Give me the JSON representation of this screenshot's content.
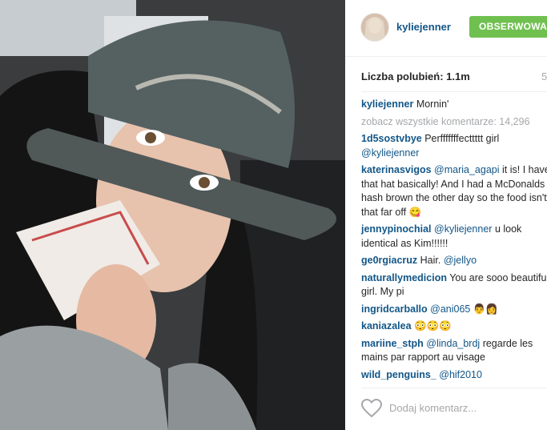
{
  "post": {
    "username": "kyliejenner",
    "follow_label": "OBSERWOWANE",
    "likes_label": "Liczba polubień: 1.1m",
    "time": "5",
    "caption": {
      "user": "kyliejenner",
      "text": "Mornin'"
    },
    "view_all": "zobacz wszystkie komentarze: 14,296",
    "add_comment_placeholder": "Dodaj komentarz..."
  },
  "comments": [
    {
      "user": "1d5sostvbye",
      "mention": "",
      "text": "Perfffffffecttttt girl",
      "mention2": "@kyliejenner"
    },
    {
      "user": "katerinasvigos",
      "mention": "@maria_agapi",
      "text": "it is! I have that hat basically! And I had a McDonalds hash brown the other day so the food isn't that far off 😋"
    },
    {
      "user": "jennypinochial",
      "mention": "@kyliejenner",
      "text": "u look identical as Kim!!!!!!"
    },
    {
      "user": "ge0rgiacruz",
      "mention": "",
      "text": "Hair.",
      "mention2": "@jellyo"
    },
    {
      "user": "naturallymedicion",
      "mention": "",
      "text": "You are sooo beautiful girl. My pi"
    },
    {
      "user": "ingridcarballo",
      "mention": "@ani065",
      "text": "👨‍👩"
    },
    {
      "user": "kaniazalea",
      "mention": "",
      "text": "😳😳😳"
    },
    {
      "user": "mariine_stph",
      "mention": "@linda_brdj",
      "text": "regarde les mains par rapport au visage"
    },
    {
      "user": "wild_penguins_",
      "mention": "@hif2010",
      "text": ""
    }
  ],
  "colors": {
    "username": "#125688",
    "follow": "#70c050",
    "muted": "#a5a7aa"
  },
  "icons": [
    "heart-icon"
  ]
}
